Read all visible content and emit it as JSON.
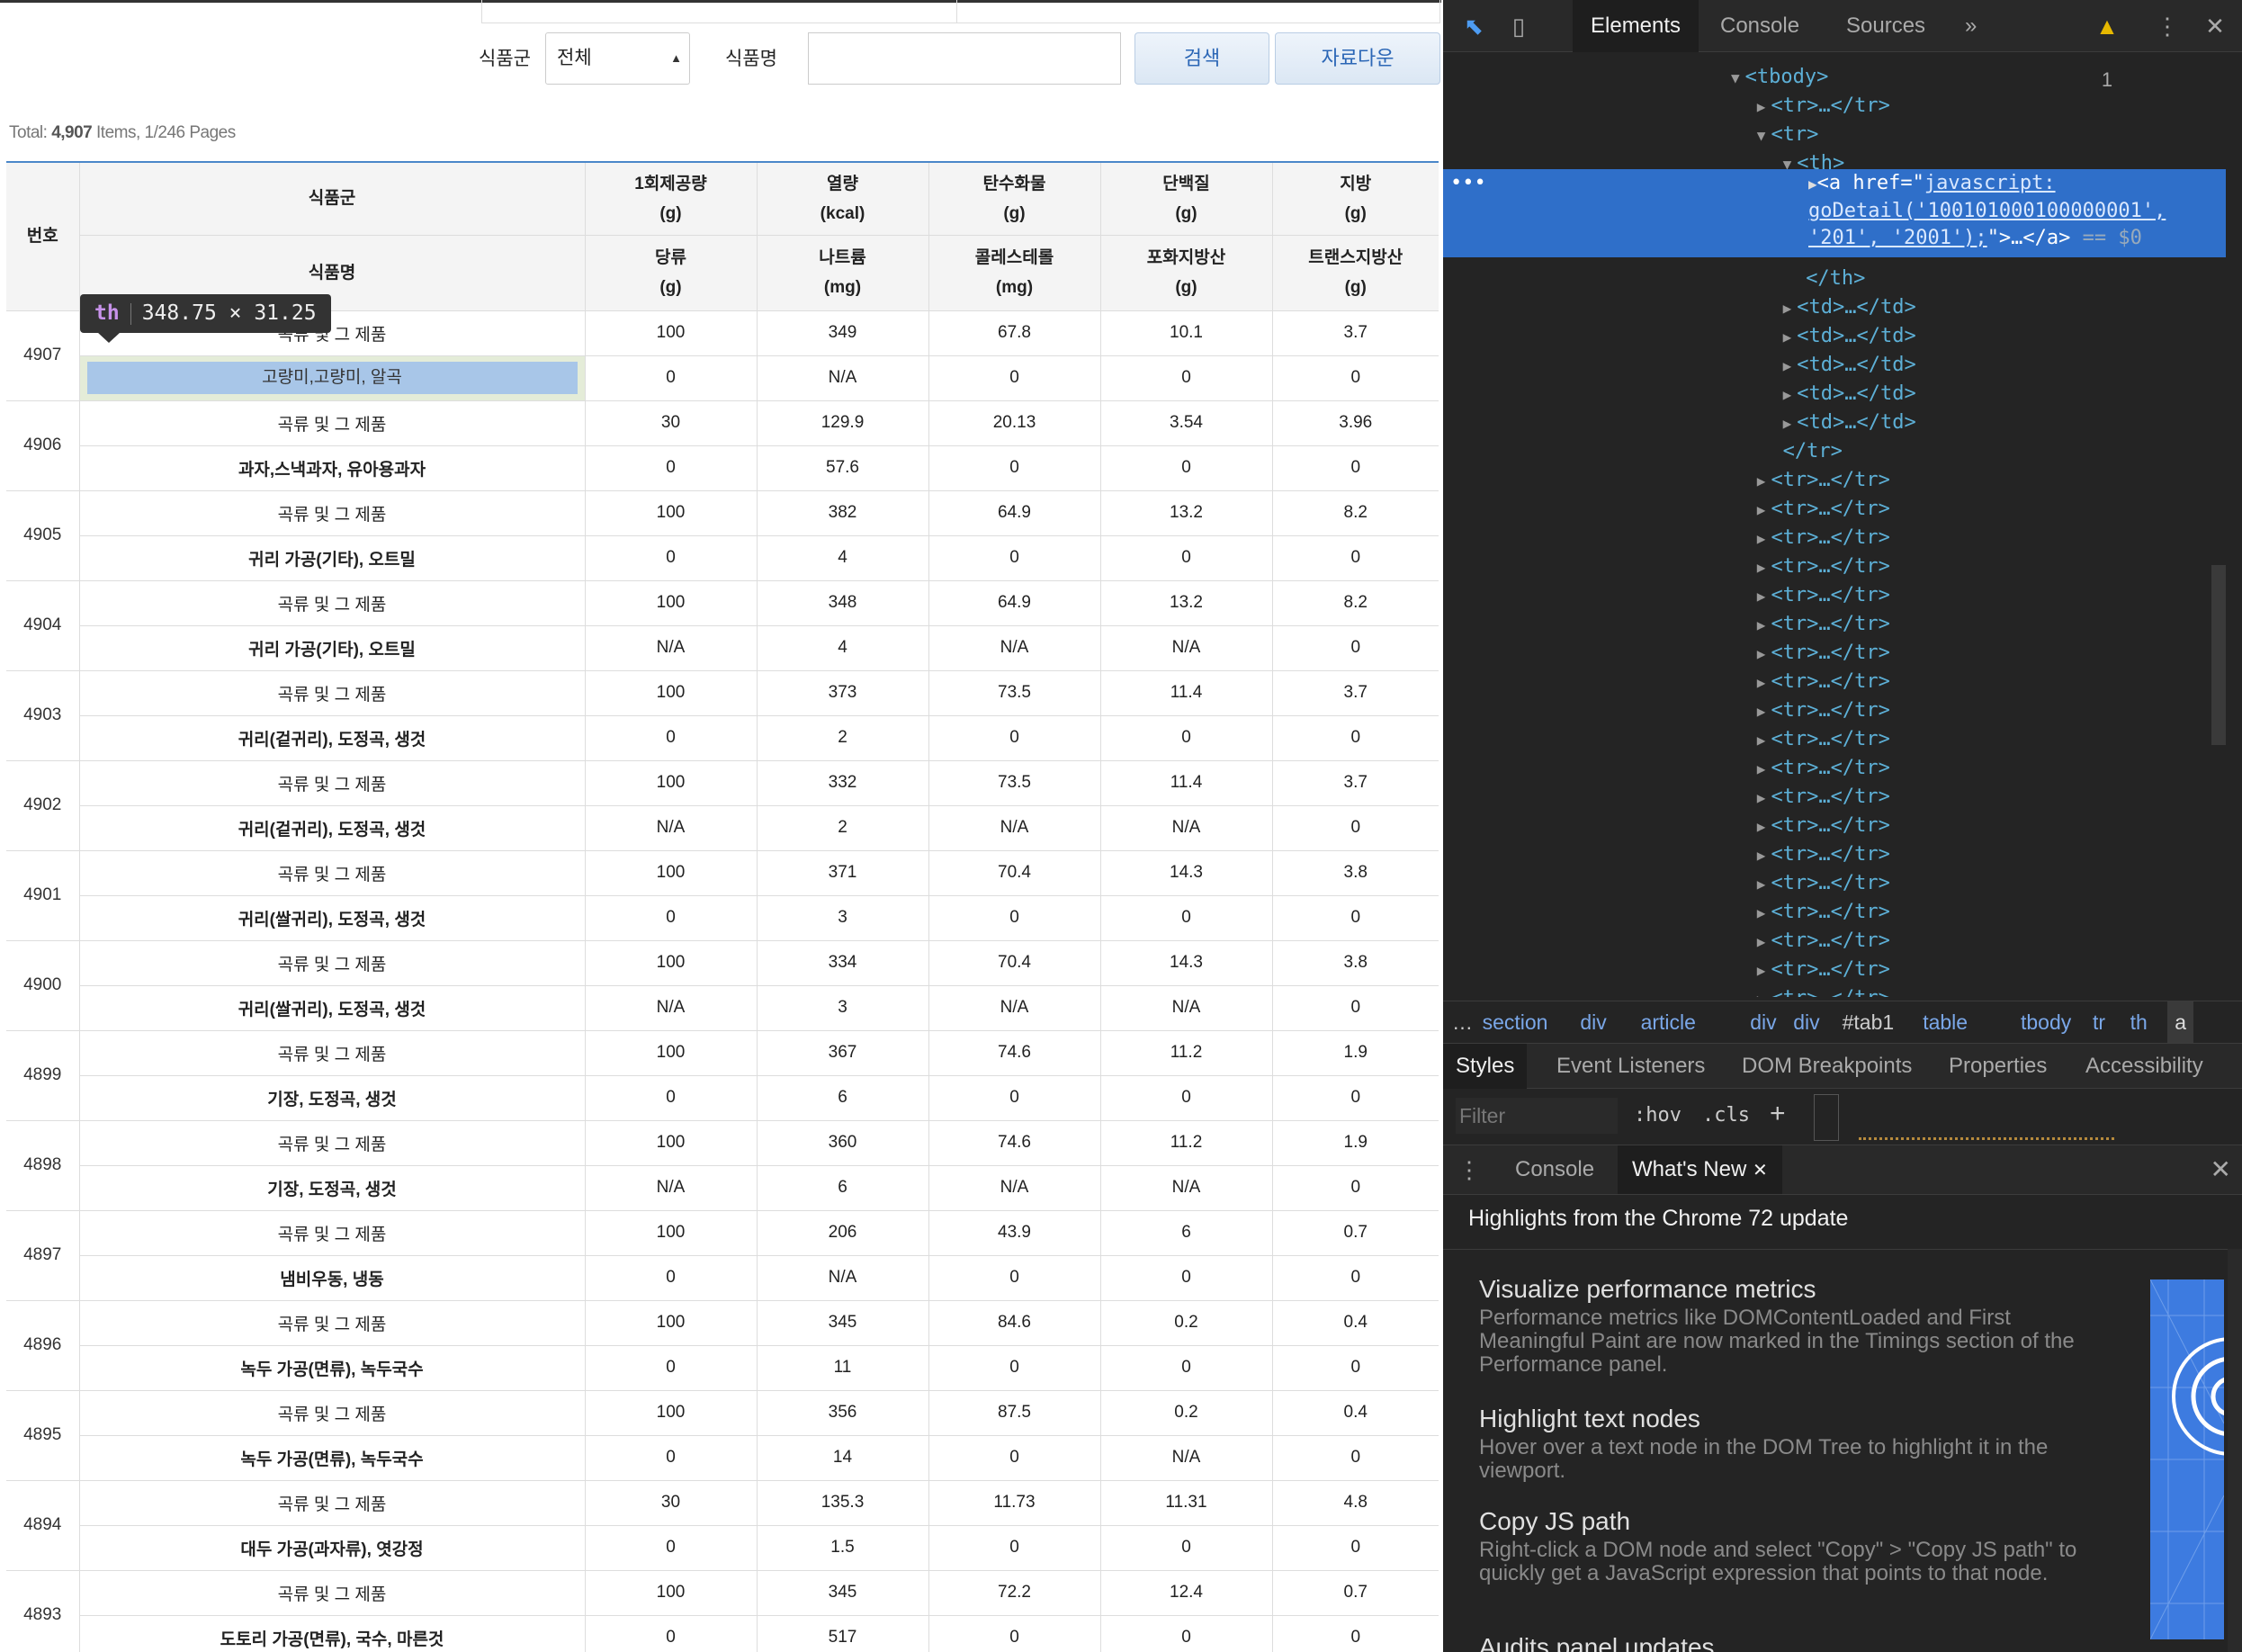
{
  "search": {
    "food_group_label": "식품군",
    "food_group_selected": "전체",
    "food_name_label": "식품명",
    "food_name_value": "",
    "search_button": "검색",
    "download_button": "자료다운"
  },
  "total": {
    "prefix": "Total: ",
    "count": "4,907",
    "suffix": " Items, 1/246 Pages"
  },
  "table": {
    "header": {
      "num": "번호",
      "group": "식품군",
      "name": "식품명",
      "cols_top": [
        [
          "1회제공량",
          "(g)"
        ],
        [
          "열량",
          "(kcal)"
        ],
        [
          "탄수화물",
          "(g)"
        ],
        [
          "단백질",
          "(g)"
        ],
        [
          "지방",
          "(g)"
        ]
      ],
      "cols_bottom": [
        [
          "당류",
          "(g)"
        ],
        [
          "나트륨",
          "(mg)"
        ],
        [
          "콜레스테롤",
          "(mg)"
        ],
        [
          "포화지방산",
          "(g)"
        ],
        [
          "트랜스지방산",
          "(g)"
        ]
      ]
    },
    "rows": [
      {
        "num": "4907",
        "group": "곡류 및 그 제품",
        "name": "고량미,고량미, 알곡",
        "top": [
          "100",
          "349",
          "67.8",
          "10.1",
          "3.7"
        ],
        "bottom": [
          "0",
          "N/A",
          "0",
          "0",
          "0"
        ]
      },
      {
        "num": "4906",
        "group": "곡류 및 그 제품",
        "name": "과자,스낵과자, 유아용과자",
        "top": [
          "30",
          "129.9",
          "20.13",
          "3.54",
          "3.96"
        ],
        "bottom": [
          "0",
          "57.6",
          "0",
          "0",
          "0"
        ]
      },
      {
        "num": "4905",
        "group": "곡류 및 그 제품",
        "name": "귀리 가공(기타), 오트밀",
        "top": [
          "100",
          "382",
          "64.9",
          "13.2",
          "8.2"
        ],
        "bottom": [
          "0",
          "4",
          "0",
          "0",
          "0"
        ]
      },
      {
        "num": "4904",
        "group": "곡류 및 그 제품",
        "name": "귀리 가공(기타), 오트밀",
        "top": [
          "100",
          "348",
          "64.9",
          "13.2",
          "8.2"
        ],
        "bottom": [
          "N/A",
          "4",
          "N/A",
          "N/A",
          "0"
        ]
      },
      {
        "num": "4903",
        "group": "곡류 및 그 제품",
        "name": "귀리(겉귀리), 도정곡, 생것",
        "top": [
          "100",
          "373",
          "73.5",
          "11.4",
          "3.7"
        ],
        "bottom": [
          "0",
          "2",
          "0",
          "0",
          "0"
        ]
      },
      {
        "num": "4902",
        "group": "곡류 및 그 제품",
        "name": "귀리(겉귀리), 도정곡, 생것",
        "top": [
          "100",
          "332",
          "73.5",
          "11.4",
          "3.7"
        ],
        "bottom": [
          "N/A",
          "2",
          "N/A",
          "N/A",
          "0"
        ]
      },
      {
        "num": "4901",
        "group": "곡류 및 그 제품",
        "name": "귀리(쌀귀리), 도정곡, 생것",
        "top": [
          "100",
          "371",
          "70.4",
          "14.3",
          "3.8"
        ],
        "bottom": [
          "0",
          "3",
          "0",
          "0",
          "0"
        ]
      },
      {
        "num": "4900",
        "group": "곡류 및 그 제품",
        "name": "귀리(쌀귀리), 도정곡, 생것",
        "top": [
          "100",
          "334",
          "70.4",
          "14.3",
          "3.8"
        ],
        "bottom": [
          "N/A",
          "3",
          "N/A",
          "N/A",
          "0"
        ]
      },
      {
        "num": "4899",
        "group": "곡류 및 그 제품",
        "name": "기장, 도정곡, 생것",
        "top": [
          "100",
          "367",
          "74.6",
          "11.2",
          "1.9"
        ],
        "bottom": [
          "0",
          "6",
          "0",
          "0",
          "0"
        ]
      },
      {
        "num": "4898",
        "group": "곡류 및 그 제품",
        "name": "기장, 도정곡, 생것",
        "top": [
          "100",
          "360",
          "74.6",
          "11.2",
          "1.9"
        ],
        "bottom": [
          "N/A",
          "6",
          "N/A",
          "N/A",
          "0"
        ]
      },
      {
        "num": "4897",
        "group": "곡류 및 그 제품",
        "name": "냄비우동, 냉동",
        "top": [
          "100",
          "206",
          "43.9",
          "6",
          "0.7"
        ],
        "bottom": [
          "0",
          "N/A",
          "0",
          "0",
          "0"
        ]
      },
      {
        "num": "4896",
        "group": "곡류 및 그 제품",
        "name": "녹두 가공(면류), 녹두국수",
        "top": [
          "100",
          "345",
          "84.6",
          "0.2",
          "0.4"
        ],
        "bottom": [
          "0",
          "11",
          "0",
          "0",
          "0"
        ]
      },
      {
        "num": "4895",
        "group": "곡류 및 그 제품",
        "name": "녹두 가공(면류), 녹두국수",
        "top": [
          "100",
          "356",
          "87.5",
          "0.2",
          "0.4"
        ],
        "bottom": [
          "0",
          "14",
          "0",
          "N/A",
          "0"
        ]
      },
      {
        "num": "4894",
        "group": "곡류 및 그 제품",
        "name": "대두 가공(과자류), 엿강정",
        "top": [
          "30",
          "135.3",
          "11.73",
          "11.31",
          "4.8"
        ],
        "bottom": [
          "0",
          "1.5",
          "0",
          "0",
          "0"
        ]
      },
      {
        "num": "4893",
        "group": "곡류 및 그 제품",
        "name": "도토리 가공(면류), 국수, 마른것",
        "top": [
          "100",
          "345",
          "72.2",
          "12.4",
          "0.7"
        ],
        "bottom": [
          "0",
          "517",
          "0",
          "0",
          "0"
        ]
      }
    ]
  },
  "inspect_tooltip": {
    "tag": "th",
    "size": "348.75 × 31.25"
  },
  "devtools": {
    "tabs": [
      "Elements",
      "Console",
      "Sources"
    ],
    "more": "»",
    "warning_count": "1",
    "dom": {
      "tbody_open": "<tbody>",
      "tr_collapsed": "<tr>…</tr>",
      "tr_open": "<tr>",
      "th_open": "<th>",
      "sel_line1": "<a href=\"",
      "sel_href1": "javascript:",
      "sel_href2": "goDetail('100101000100000001',",
      "sel_href3": "'201', '2001');",
      "sel_tail": "\">…</a>",
      "sel_eq": " == $0",
      "th_close": "</th>",
      "td_collapsed": "<td>…</td>",
      "tr_close": "</tr>"
    },
    "breadcrumbs": [
      "section",
      "div",
      "article",
      "div",
      "div",
      "#tab1",
      "table",
      "tbody",
      "tr",
      "th",
      "a"
    ],
    "breadcrumb_more": "…",
    "style_tabs": [
      "Styles",
      "Event Listeners",
      "DOM Breakpoints",
      "Properties",
      "Accessibility"
    ],
    "filter_placeholder": "Filter",
    "hov": ":hov",
    "cls": ".cls",
    "plus": "+",
    "drawer_tabs": [
      "Console",
      "What's New"
    ],
    "whats_new": {
      "heading": "Highlights from the Chrome 72 update",
      "items": [
        {
          "title": "Visualize performance metrics",
          "desc": "Performance metrics like DOMContentLoaded and First Meaningful Paint are now marked in the Timings section of the Performance panel."
        },
        {
          "title": "Highlight text nodes",
          "desc": "Hover over a text node in the DOM Tree to highlight it in the viewport."
        },
        {
          "title": "Copy JS path",
          "desc": "Right-click a DOM node and select \"Copy\" > \"Copy JS path\" to quickly get a JavaScript expression that points to that node."
        },
        {
          "title": "Audits panel updates",
          "desc": ""
        }
      ]
    },
    "colors": {
      "selection": "#2f6fc9",
      "tag": "#5db0d7",
      "table_header_border": "#4a87c9",
      "highlight": "#a8c6e8"
    }
  }
}
